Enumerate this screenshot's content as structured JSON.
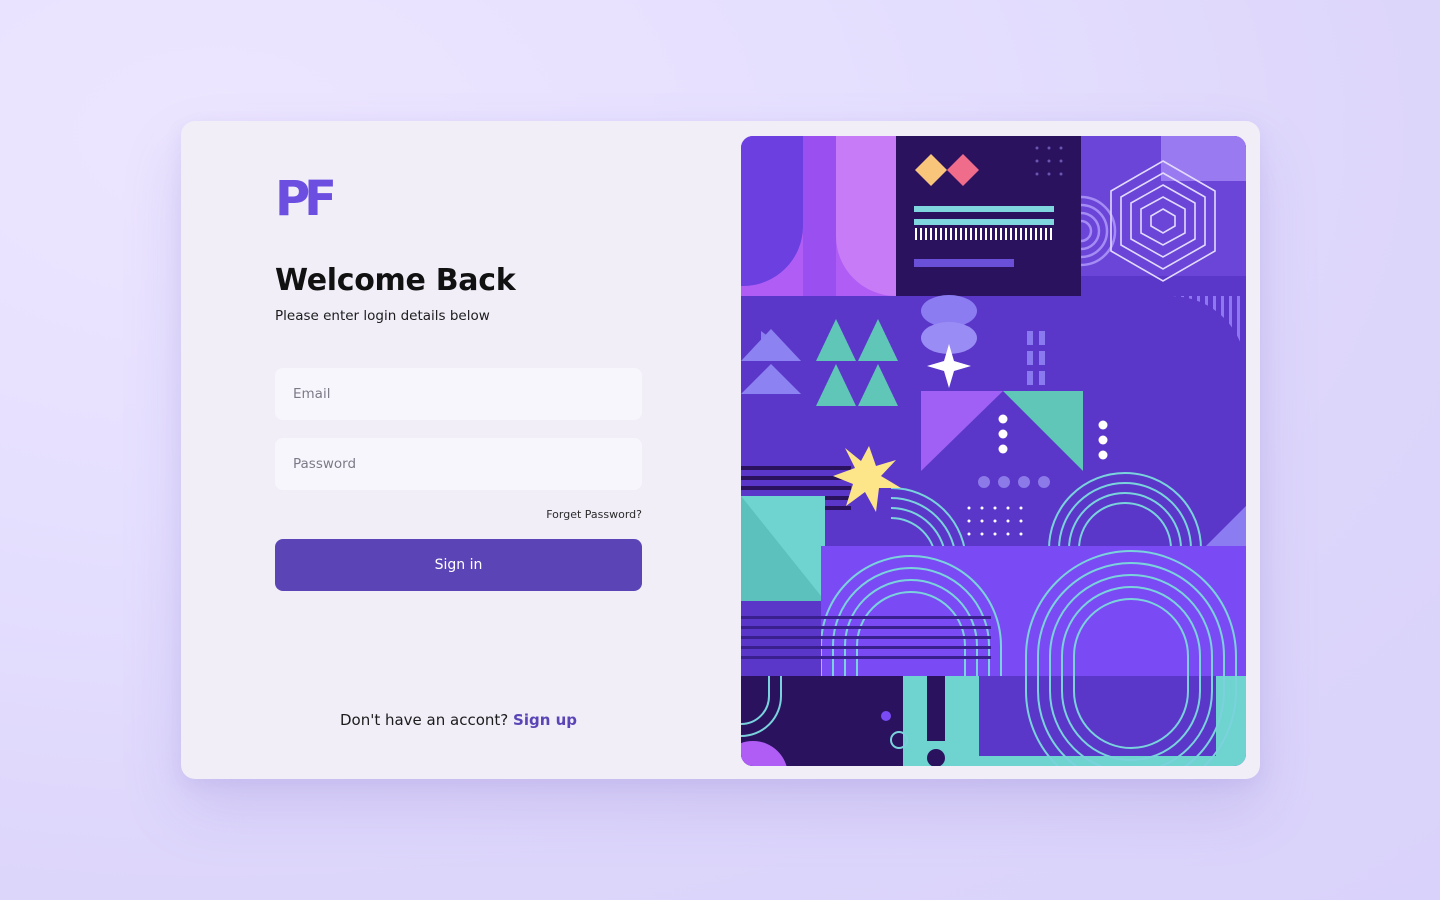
{
  "brand": {
    "logo_text": "PF",
    "logo_color": "#6c4fe0"
  },
  "login": {
    "title": "Welcome Back",
    "subtitle": "Please enter login details below",
    "email_placeholder": "Email",
    "password_placeholder": "Password",
    "forgot_label": "Forget Password?",
    "signin_label": "Sign in",
    "no_account_text": "Don't have an accont?",
    "signup_label": "Sign up"
  },
  "colors": {
    "accent": "#5b45b6",
    "card_background": "#f1eef8",
    "art_purple": "#6b3fe0",
    "art_teal": "#6fd3d0",
    "art_yellow": "#fde58a"
  }
}
